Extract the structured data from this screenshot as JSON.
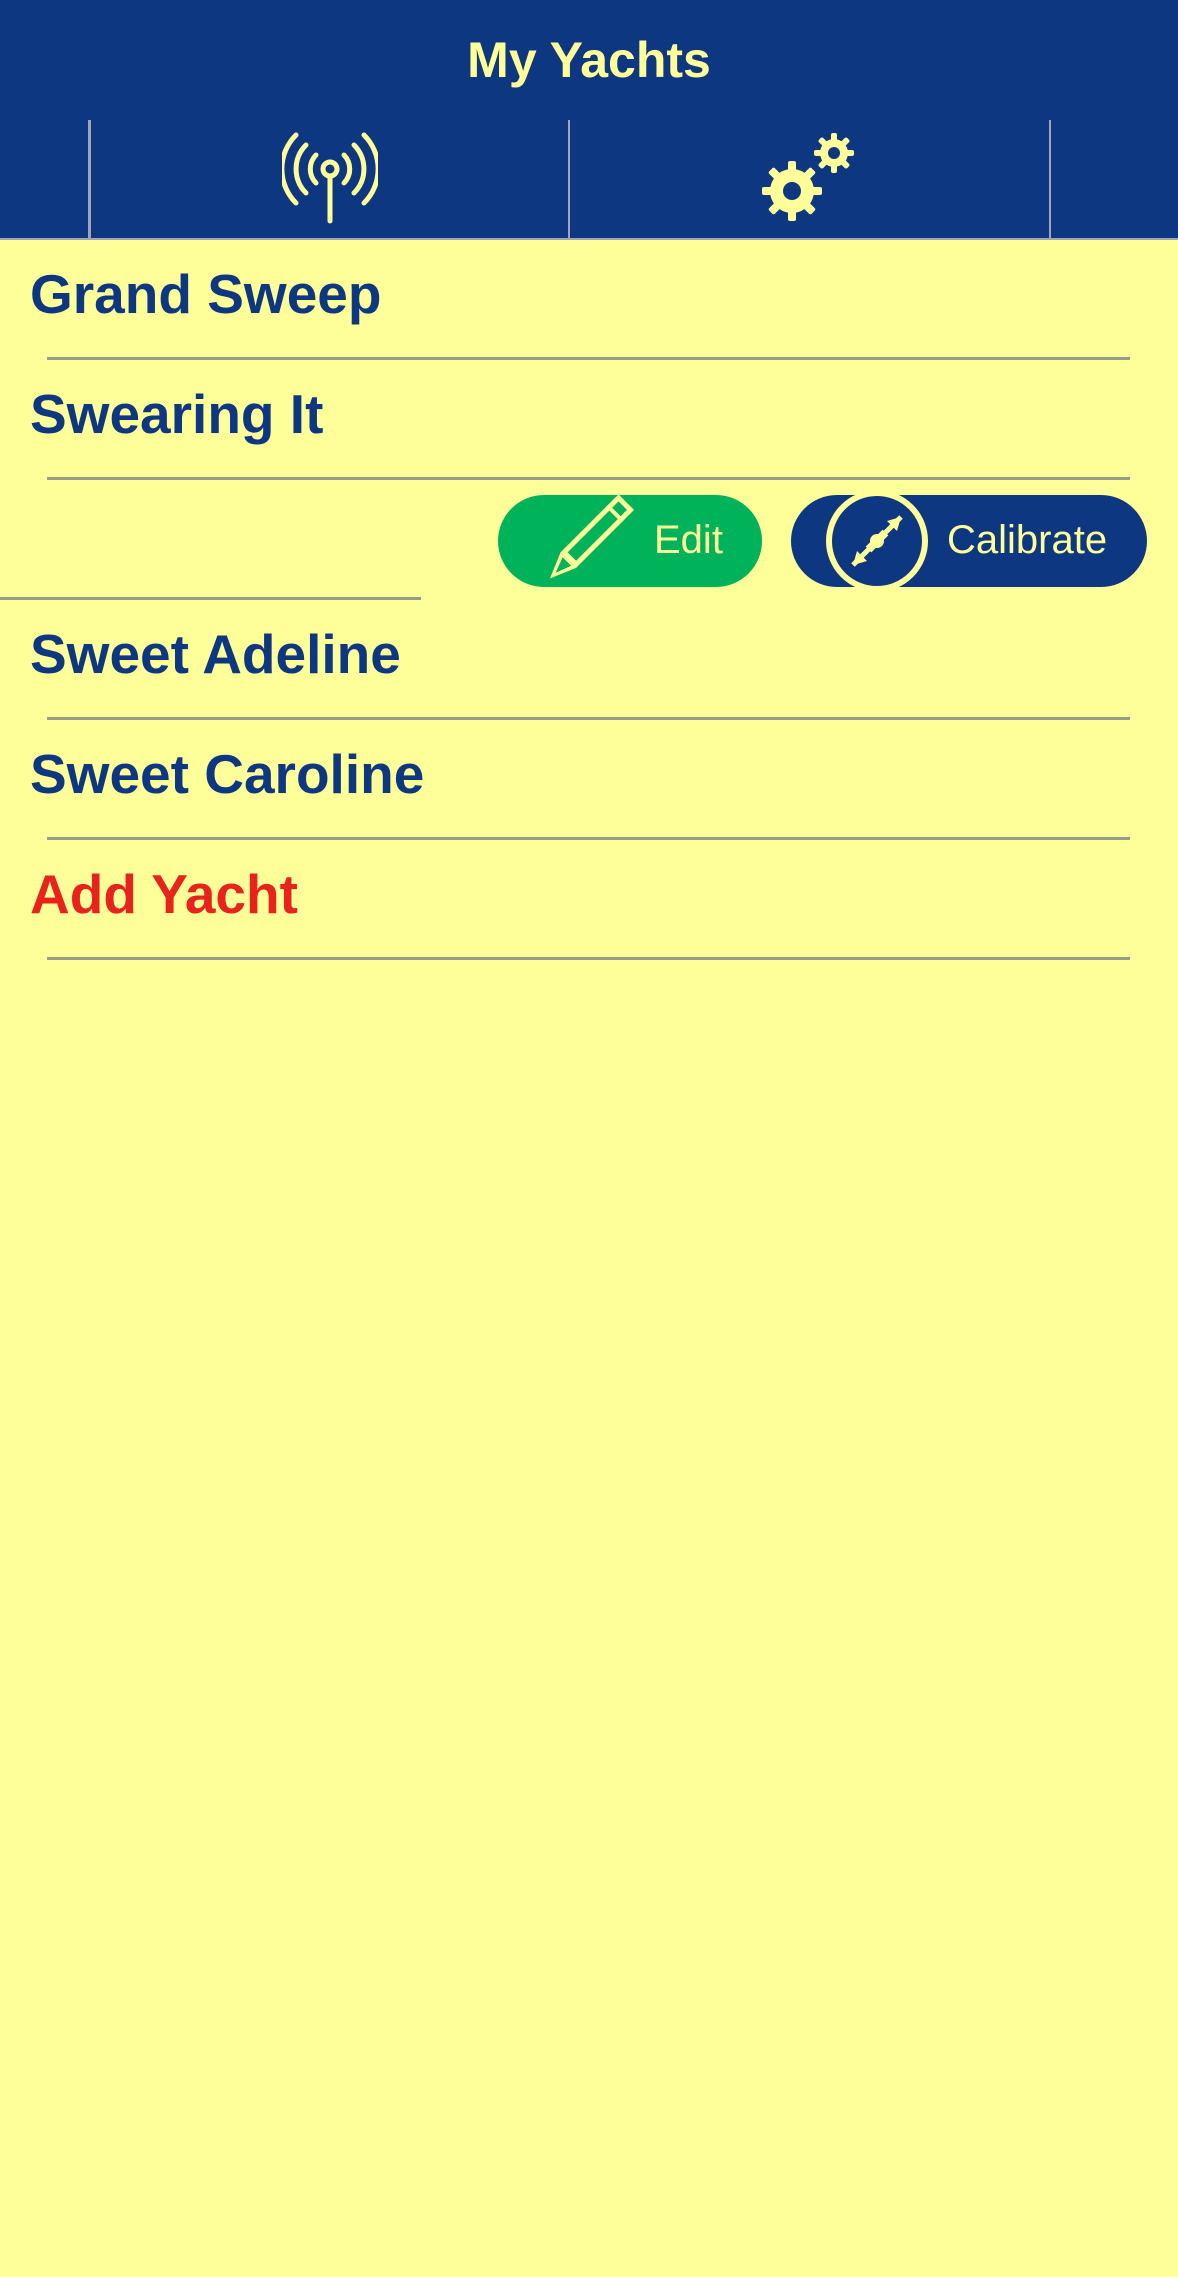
{
  "header": {
    "title": "My Yachts"
  },
  "toolbar": {
    "items": [
      {
        "icon": "antenna-icon"
      },
      {
        "icon": "gears-icon"
      }
    ]
  },
  "yachts": [
    {
      "name": "Grand Sweep"
    },
    {
      "name": "Swearing It"
    },
    {
      "name": "Sweet Adeline"
    },
    {
      "name": "Sweet Caroline"
    }
  ],
  "swipe_actions": {
    "edit_label": "Edit",
    "calibrate_label": "Calibrate"
  },
  "add_yacht_label": "Add Yacht",
  "colors": {
    "primary": "#0E3782",
    "background": "#FFFF99",
    "accent_text": "#FFFF99",
    "edit": "#00B35A",
    "add": "#E8231C"
  }
}
